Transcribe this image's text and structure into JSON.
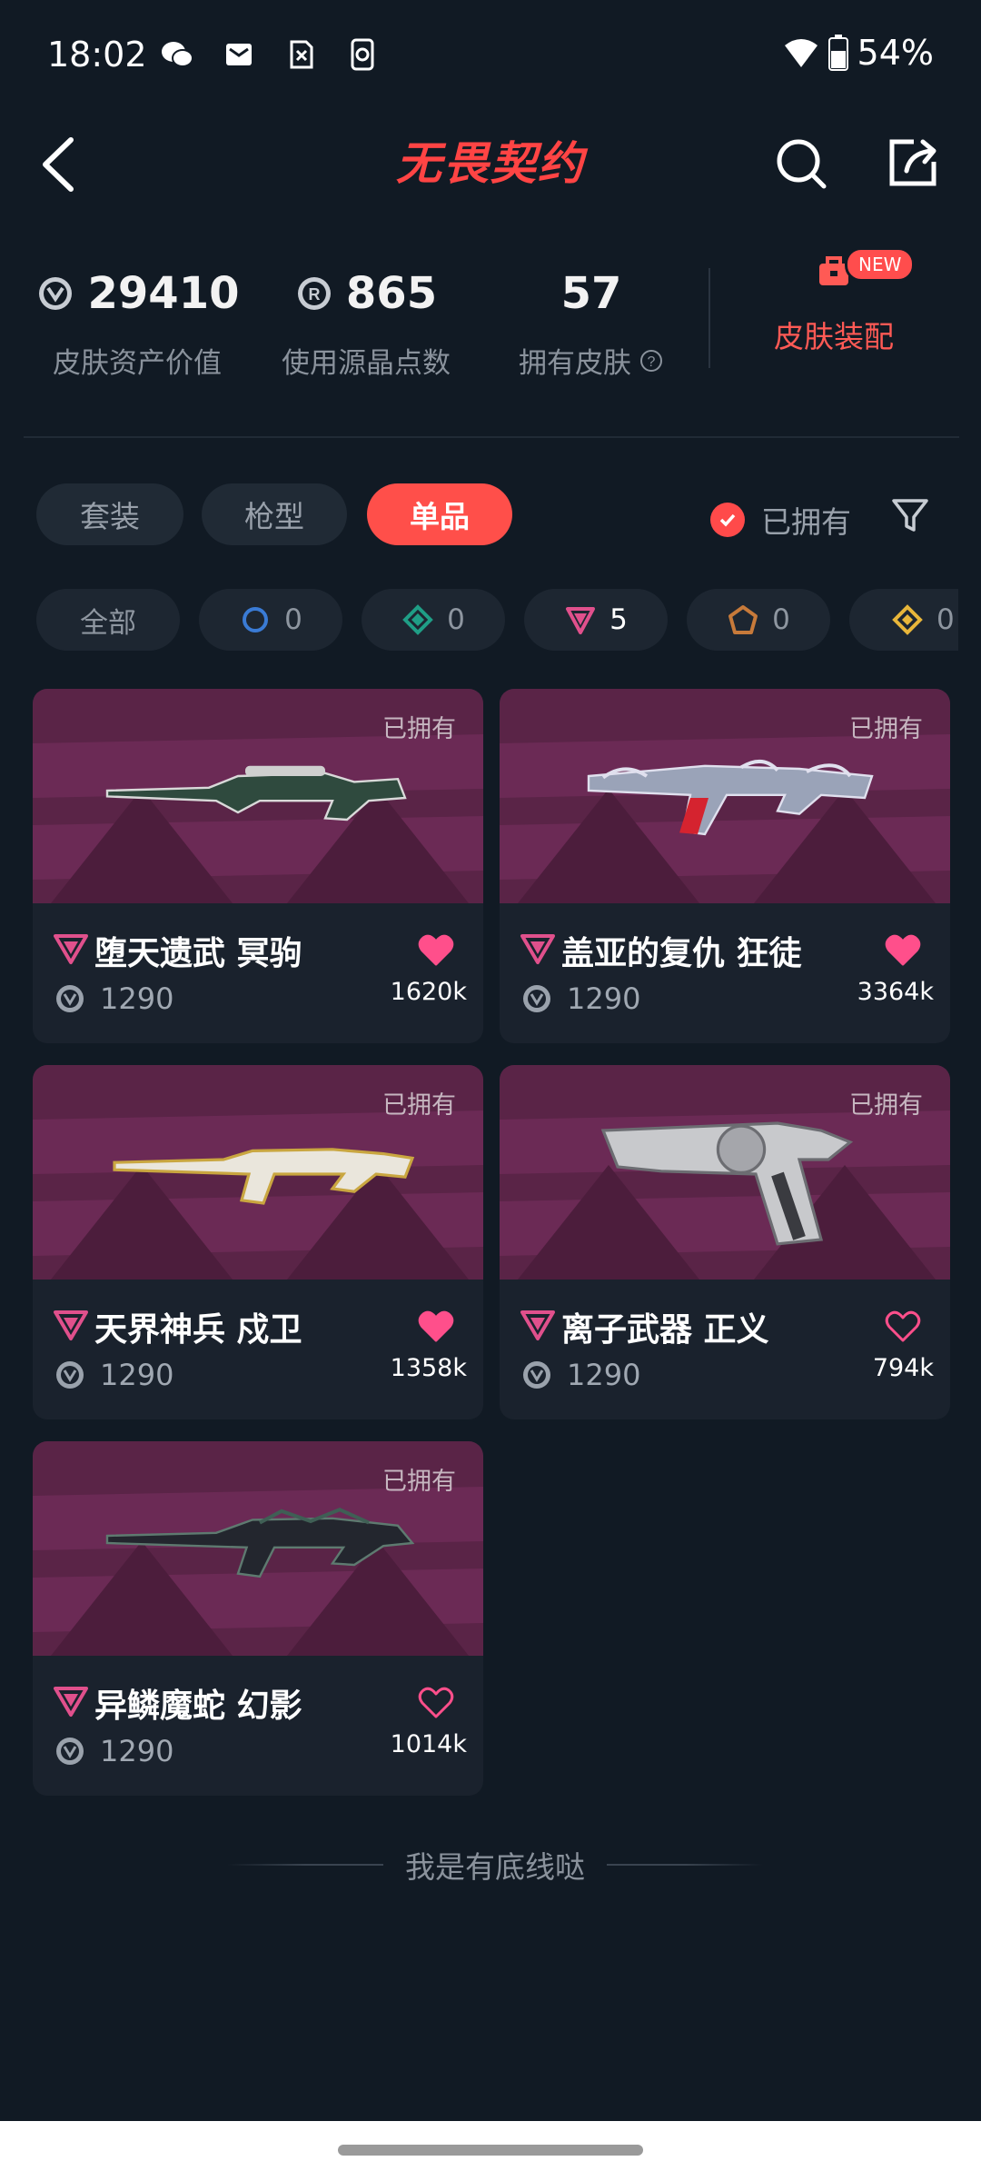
{
  "status": {
    "time": "18:02",
    "battery": "54%"
  },
  "header": {
    "logo_text": "无畏契约"
  },
  "stats": [
    {
      "value": "29410",
      "label": "皮肤资产价值",
      "icon": "vp-coin-icon"
    },
    {
      "value": "865",
      "label": "使用源晶点数",
      "icon": "radianite-icon"
    },
    {
      "value": "57",
      "label": "拥有皮肤",
      "icon": "help-icon"
    }
  ],
  "outfit": {
    "label": "皮肤装配",
    "badge": "NEW"
  },
  "tabs": [
    {
      "label": "套装",
      "active": false
    },
    {
      "label": "枪型",
      "active": false
    },
    {
      "label": "单品",
      "active": true
    }
  ],
  "owned_filter": {
    "label": "已拥有",
    "checked": true
  },
  "rarity_chips": [
    {
      "label": "全部",
      "count": "",
      "color": ""
    },
    {
      "label": "",
      "count": "0",
      "color": "#3a7bd5"
    },
    {
      "label": "",
      "count": "0",
      "color": "#1f9e86"
    },
    {
      "label": "",
      "count": "5",
      "color": "#e0508c"
    },
    {
      "label": "",
      "count": "0",
      "color": "#c77a3a"
    },
    {
      "label": "",
      "count": "0",
      "color": "#e8b63a"
    }
  ],
  "skins": [
    {
      "name": "堕天遗武 冥驹",
      "price": "1290",
      "likes": "1620k",
      "owned": "已拥有",
      "liked": true
    },
    {
      "name": "盖亚的复仇 狂徒",
      "price": "1290",
      "likes": "3364k",
      "owned": "已拥有",
      "liked": true
    },
    {
      "name": "天界神兵 戍卫",
      "price": "1290",
      "likes": "1358k",
      "owned": "已拥有",
      "liked": true
    },
    {
      "name": "离子武器 正义",
      "price": "1290",
      "likes": "794k",
      "owned": "已拥有",
      "liked": false
    },
    {
      "name": "异鳞魔蛇 幻影",
      "price": "1290",
      "likes": "1014k",
      "owned": "已拥有",
      "liked": false
    }
  ],
  "footer_text": "我是有底线哒",
  "colors": {
    "accent": "#ff4f4a",
    "background": "#111a24",
    "card": "#1a222d",
    "card_image": "#5a2447",
    "premium": "#e0508c"
  }
}
